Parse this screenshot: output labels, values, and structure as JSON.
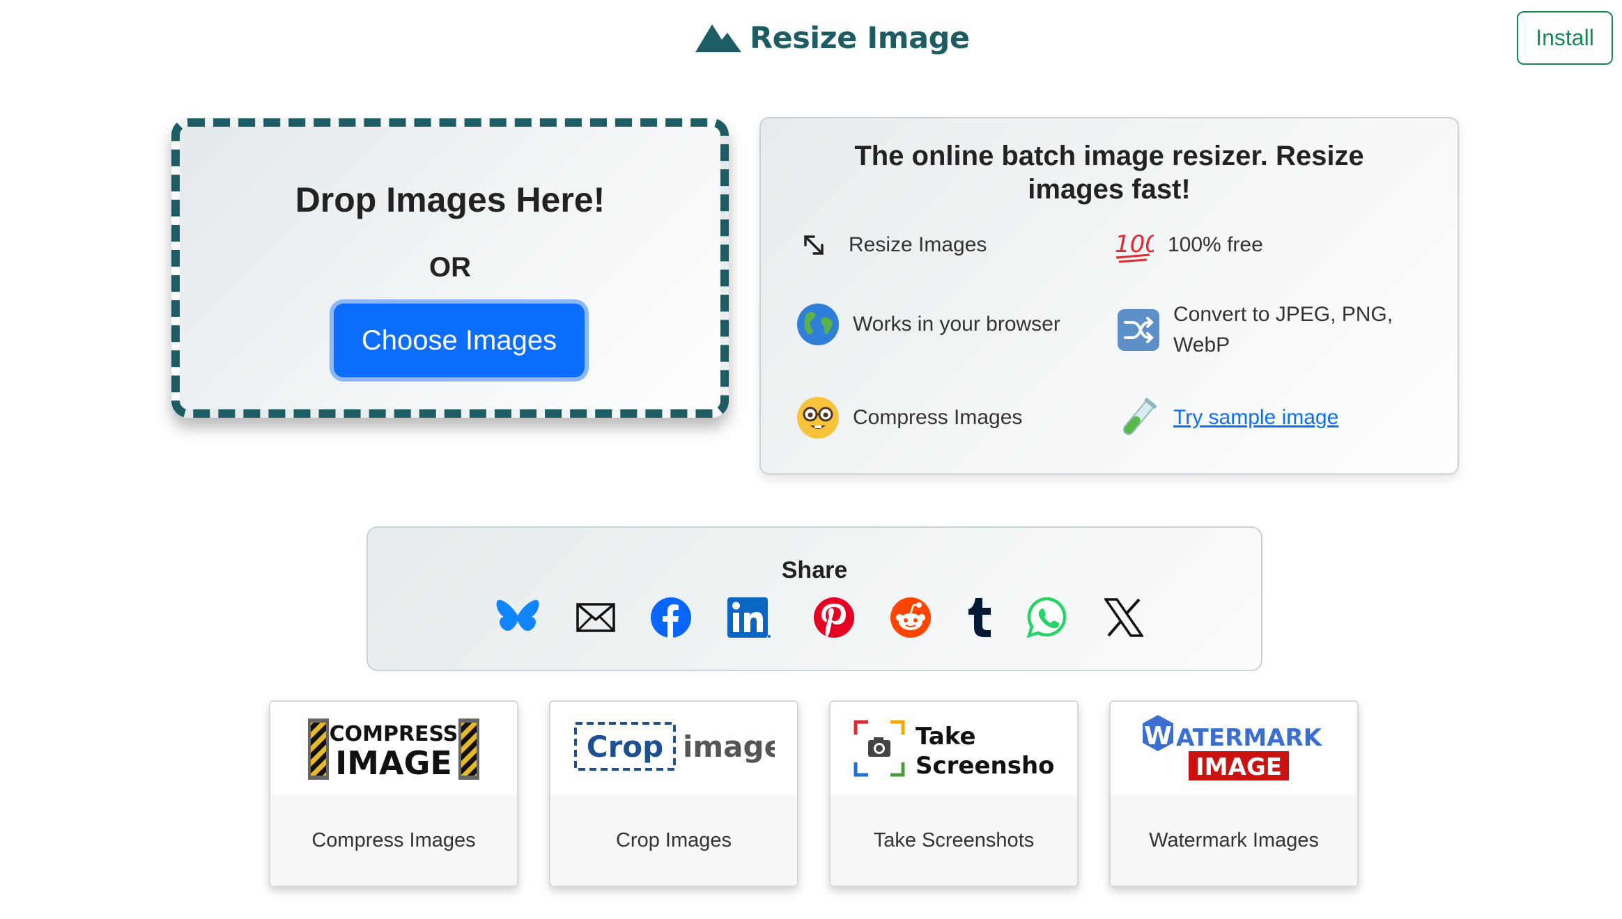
{
  "header": {
    "brand_title": "Resize Image",
    "brand_icon": "mountain-icon",
    "install_label": "Install",
    "brand_color": "#1d5c63",
    "install_color": "#198754"
  },
  "dropzone": {
    "title": "Drop Images Here!",
    "or_text": "OR",
    "choose_label": "Choose Images",
    "button_color": "#0d6efd"
  },
  "info": {
    "title": "The online batch image resizer. Resize images fast!",
    "features": [
      {
        "label": "Resize Images",
        "icon": "resize-arrow-icon"
      },
      {
        "label": "100% free",
        "icon": "hundred-points-icon"
      },
      {
        "label": "Works in your browser",
        "icon": "globe-icon"
      },
      {
        "label": "Convert to JPEG, PNG, WebP",
        "icon": "shuffle-icon"
      },
      {
        "label": "Compress Images",
        "icon": "nerd-face-icon"
      },
      {
        "label": "Try sample image",
        "icon": "test-tube-icon"
      }
    ]
  },
  "share": {
    "title": "Share",
    "networks": [
      "bluesky",
      "email",
      "facebook",
      "linkedin",
      "pinterest",
      "reddit",
      "tumblr",
      "whatsapp",
      "x"
    ]
  },
  "tools": [
    {
      "label": "Compress Images",
      "logo_line1": "COMPRESS",
      "logo_line2": "IMAGE"
    },
    {
      "label": "Crop Images",
      "logo_word1": "Crop",
      "logo_word2": "image"
    },
    {
      "label": "Take Screenshots",
      "logo_line1": "Take",
      "logo_line2": "Screenshot"
    },
    {
      "label": "Watermark Images",
      "logo_initial": "W",
      "logo_line1": "ATERMARK",
      "logo_line2": "IMAGE"
    }
  ]
}
